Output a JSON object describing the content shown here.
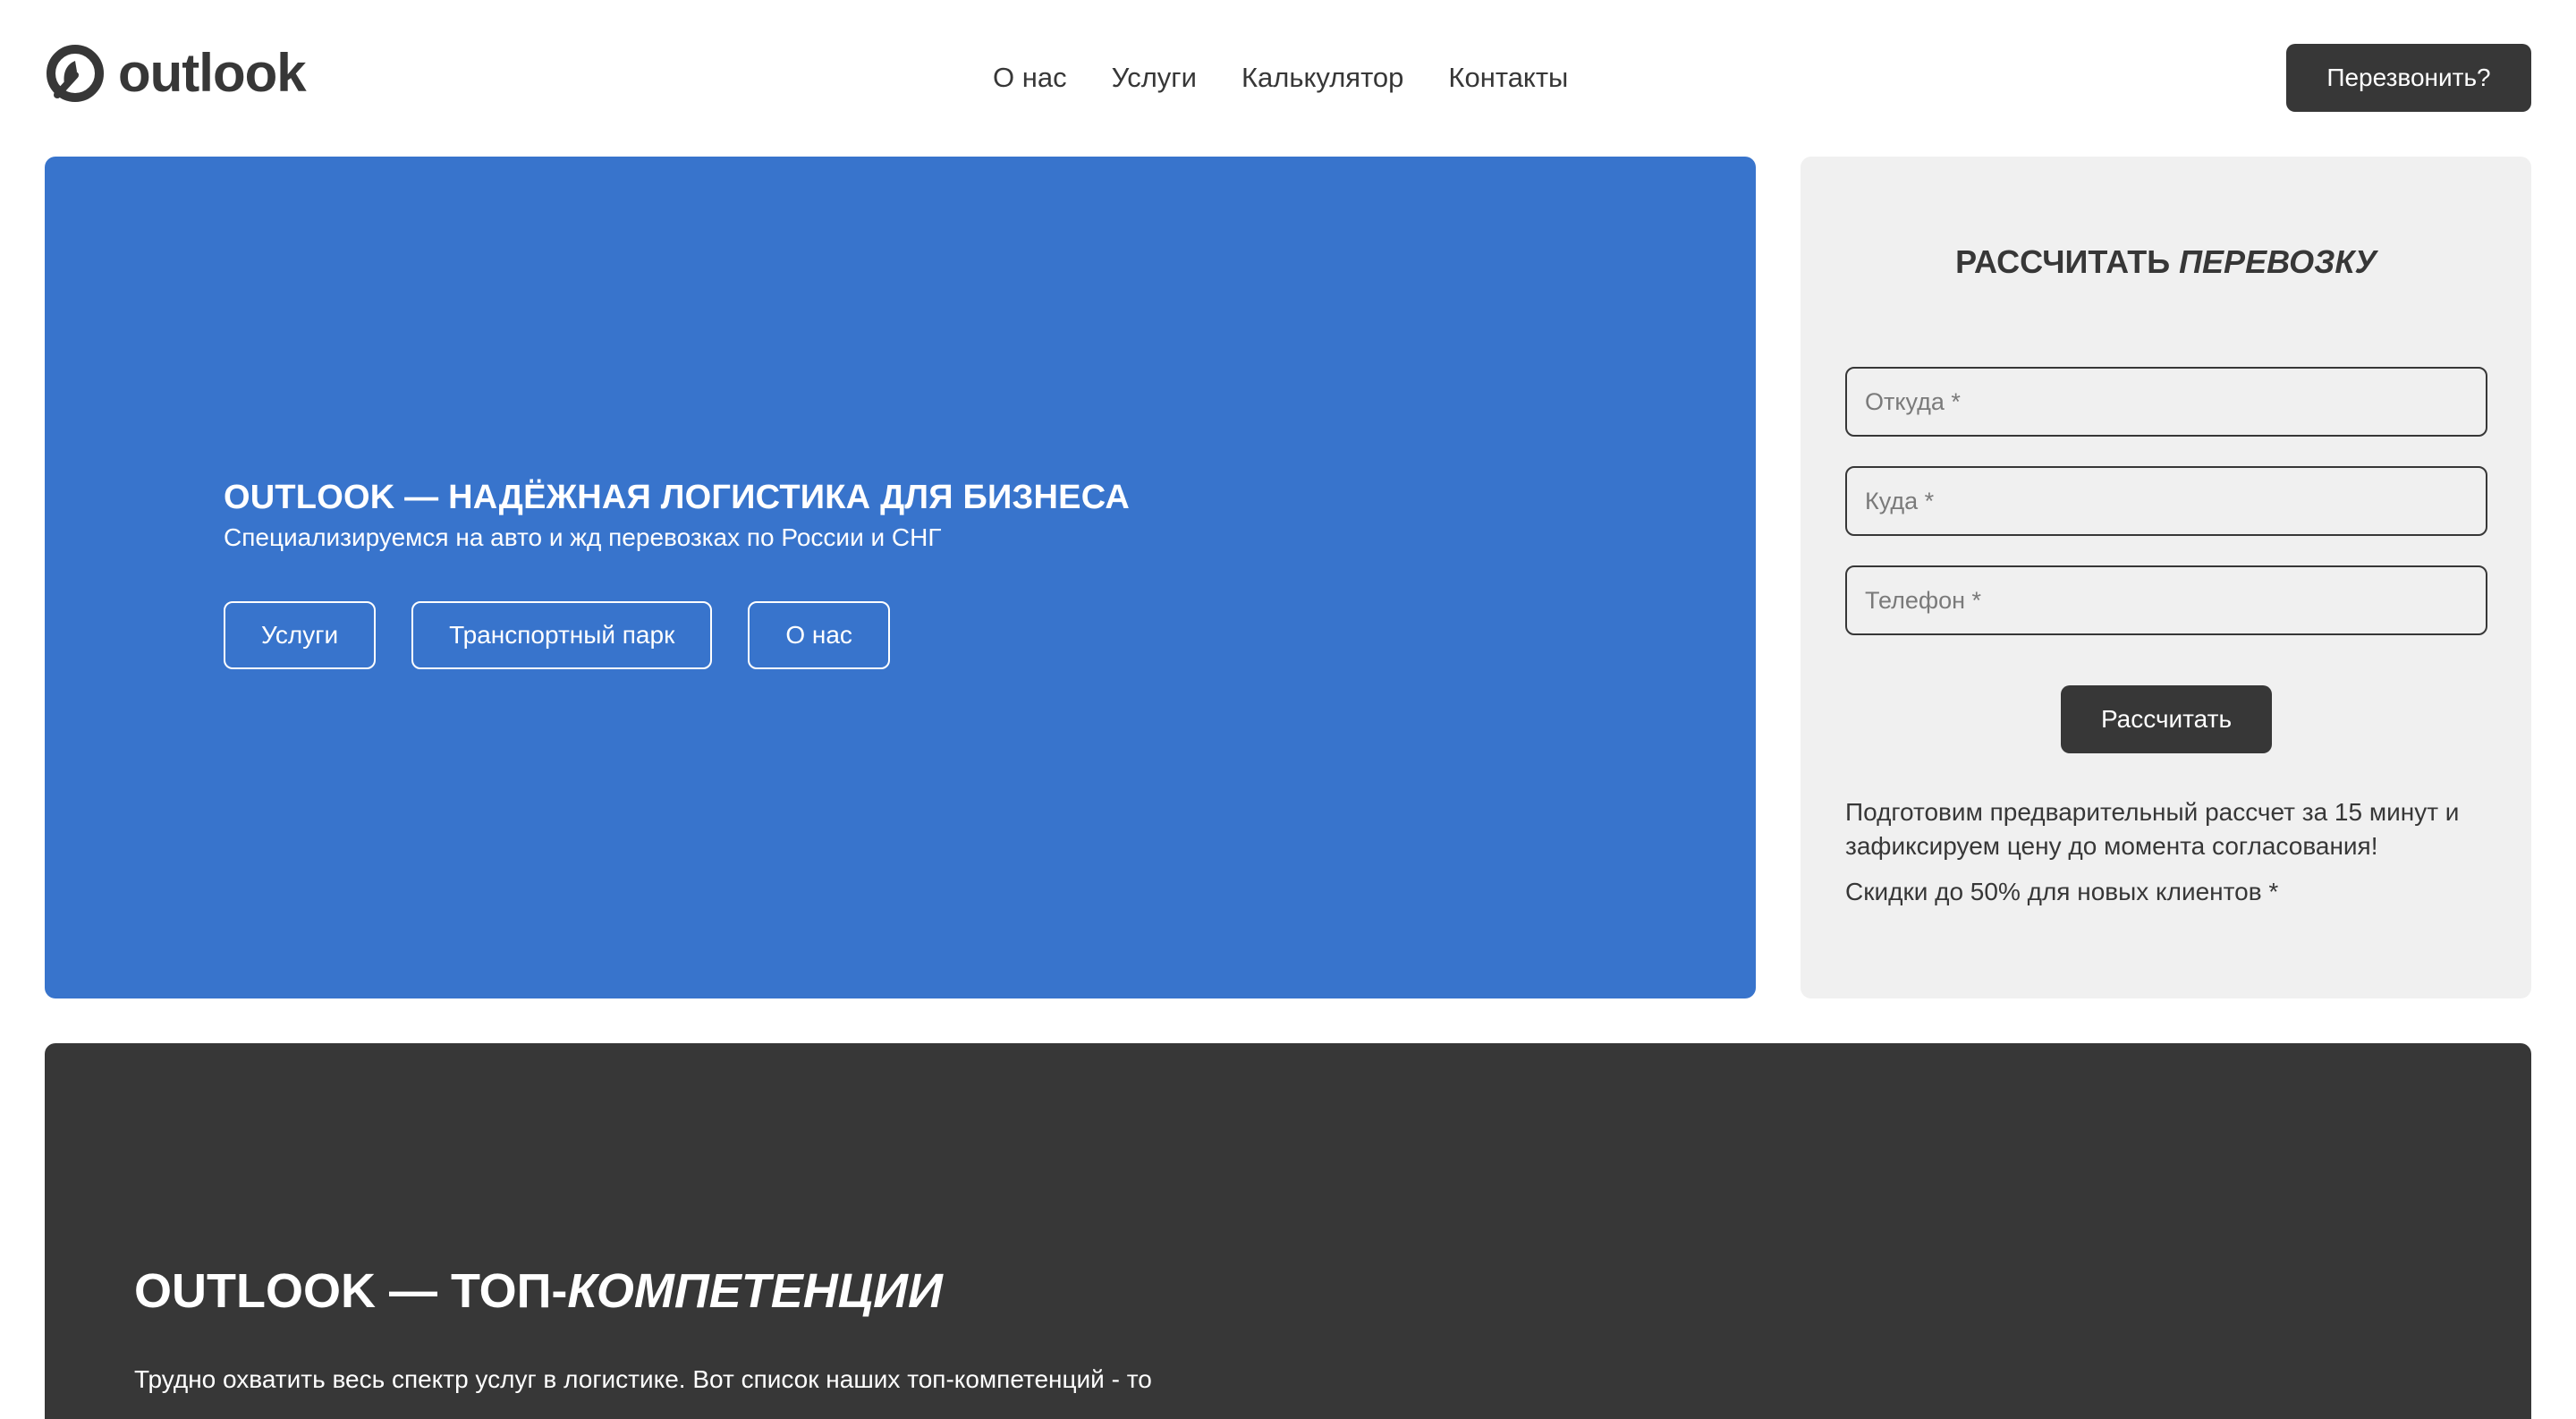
{
  "header": {
    "logo_text": "outlook",
    "nav": [
      {
        "label": "О нас"
      },
      {
        "label": "Услуги"
      },
      {
        "label": "Калькулятор"
      },
      {
        "label": "Контакты"
      }
    ],
    "callback_label": "Перезвонить?"
  },
  "hero": {
    "title": "OUTLOOK — НАДЁЖНАЯ ЛОГИСТИКА ДЛЯ БИЗНЕСА",
    "subtitle": "Специализируемся на авто и жд перевозках по России и СНГ",
    "buttons": [
      {
        "label": "Услуги"
      },
      {
        "label": "Транспортный парк"
      },
      {
        "label": "О нас"
      }
    ]
  },
  "calculator": {
    "title_prefix": "РАССЧИТАТЬ ",
    "title_emphasis": "ПЕРЕВОЗКУ",
    "from_placeholder": "Откуда *",
    "to_placeholder": "Куда *",
    "phone_placeholder": "Телефон *",
    "submit_label": "Рассчитать",
    "note": "Подготовим предварительный рассчет за 15 минут и зафиксируем цену до момента согласования!",
    "discount": "Скидки до 50% для новых клиентов *"
  },
  "competencies": {
    "title_prefix": "OUTLOOK — ТОП-",
    "title_emphasis": "КОМПЕТЕНЦИИ",
    "text": "Трудно охватить весь спектр услуг в логистике. Вот список наших топ-компетенций - то"
  },
  "colors": {
    "hero_bg": "#3874cc",
    "dark": "#373737",
    "panel_bg": "#f0f0f0"
  }
}
